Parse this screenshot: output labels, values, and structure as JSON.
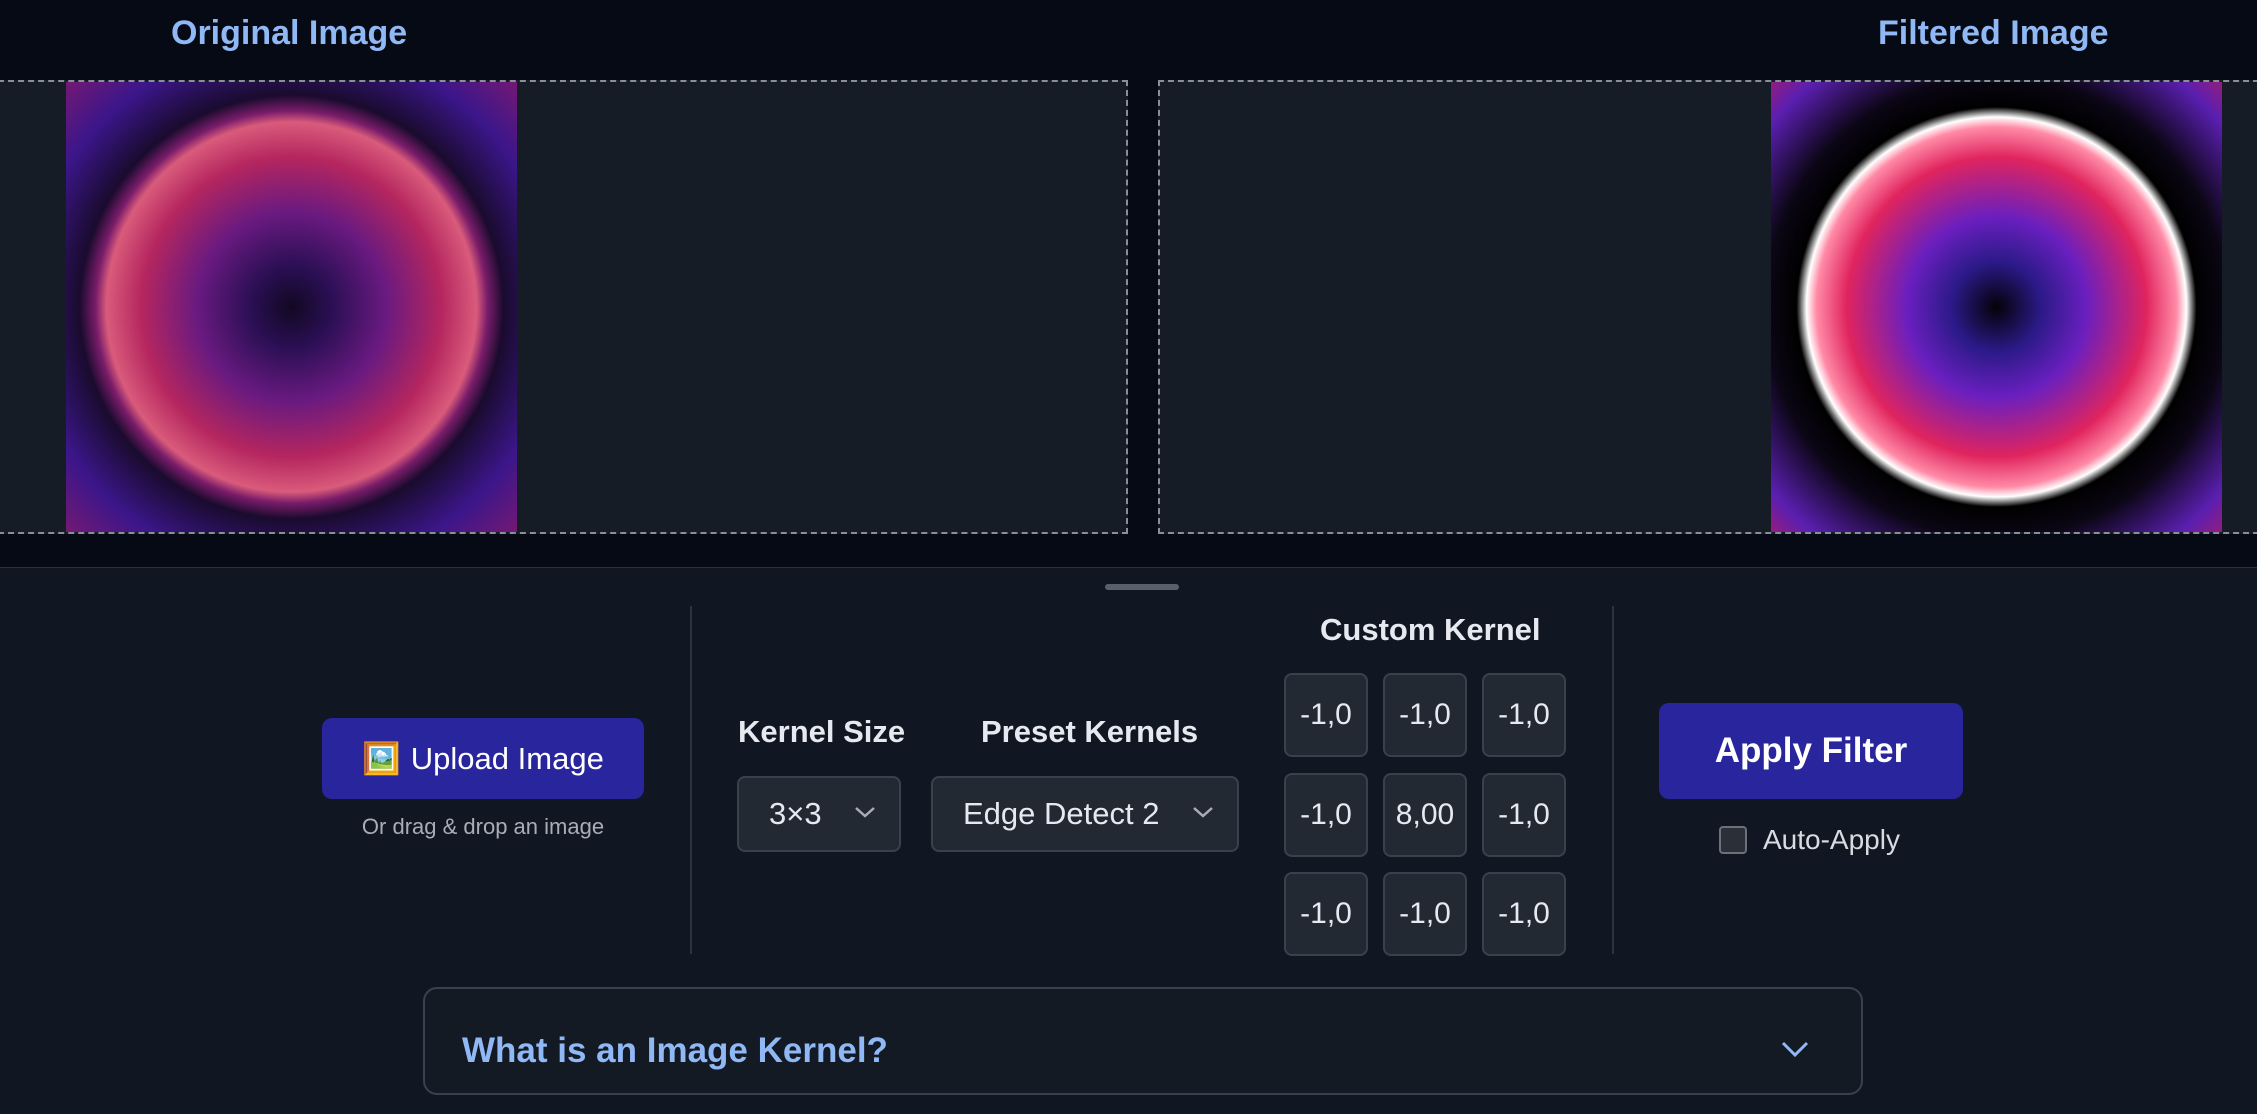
{
  "panels": {
    "original_title": "Original Image",
    "filtered_title": "Filtered Image"
  },
  "upload": {
    "button_label": "Upload Image",
    "button_emoji": "🖼️",
    "hint": "Or drag & drop an image"
  },
  "kernel_size": {
    "label": "Kernel Size",
    "selected": "3×3"
  },
  "preset_kernels": {
    "label": "Preset Kernels",
    "selected": "Edge Detect 2"
  },
  "custom_kernel": {
    "label": "Custom Kernel",
    "values": [
      "-1,0",
      "-1,0",
      "-1,0",
      "-1,0",
      "8,00",
      "-1,0",
      "-1,0",
      "-1,0",
      "-1,0"
    ]
  },
  "apply": {
    "button_label": "Apply Filter",
    "auto_apply_label": "Auto-Apply",
    "auto_apply_checked": false
  },
  "info": {
    "accordion_title": "What is an Image Kernel?"
  },
  "colors": {
    "accent_button": "#29259c",
    "heading_blue": "#8fb8f5"
  }
}
